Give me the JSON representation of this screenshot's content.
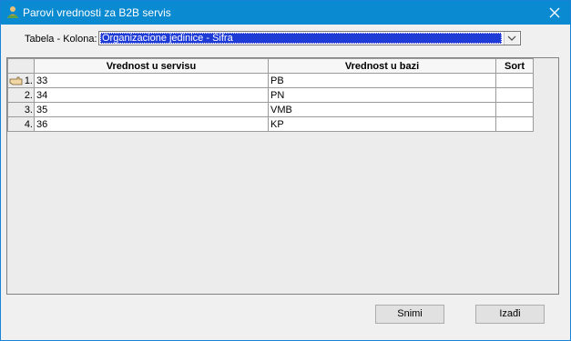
{
  "window": {
    "title": "Parovi vrednosti za B2B servis"
  },
  "form": {
    "label": "Tabela - Kolona:",
    "selected": "Organizacione jedinice - Šifra"
  },
  "grid": {
    "columns": [
      "Vrednost u servisu",
      "Vrednost u bazi",
      "Sort"
    ],
    "rows": [
      {
        "num": "1.",
        "servis": "33",
        "baza": "PB",
        "sort": ""
      },
      {
        "num": "2.",
        "servis": "34",
        "baza": "PN",
        "sort": ""
      },
      {
        "num": "3.",
        "servis": "35",
        "baza": "VMB",
        "sort": ""
      },
      {
        "num": "4.",
        "servis": "36",
        "baza": "KP",
        "sort": ""
      }
    ]
  },
  "buttons": {
    "save": "Snimi",
    "exit": "Izađi"
  },
  "icons": {
    "title": "app-icon",
    "close": "close-icon",
    "dropdown": "chevron-down-icon",
    "current_row": "pointing-hand-icon"
  }
}
